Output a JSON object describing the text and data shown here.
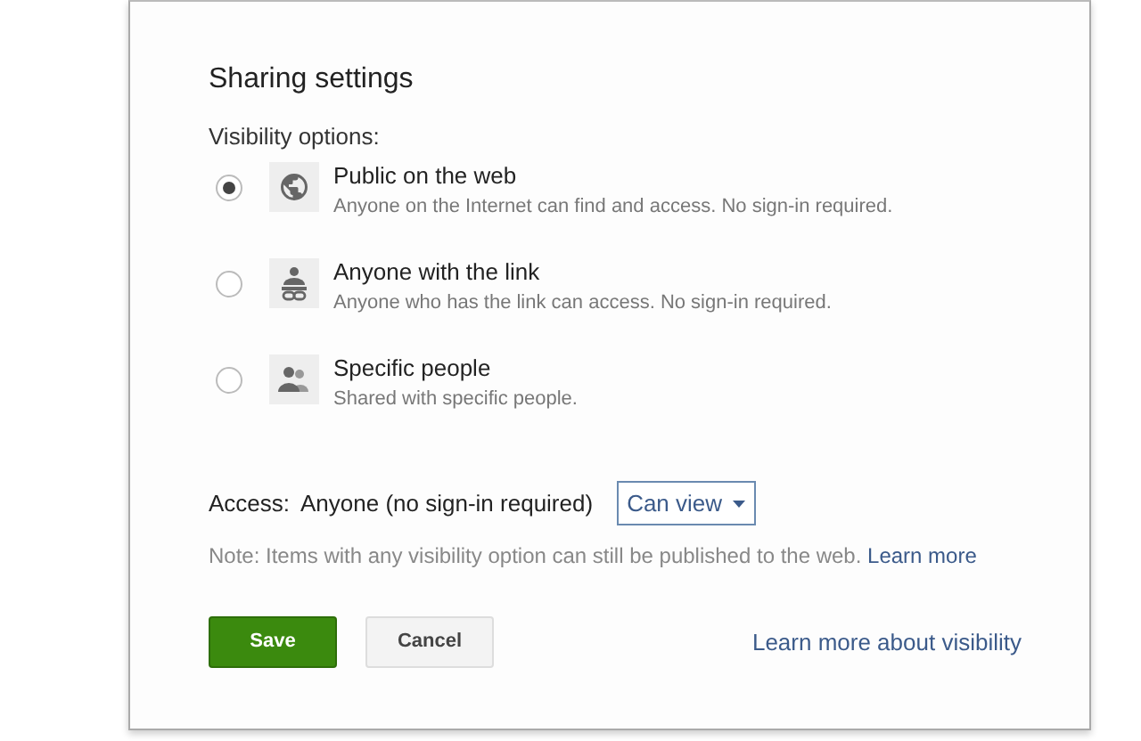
{
  "dialog": {
    "title": "Sharing settings"
  },
  "visibility": {
    "label": "Visibility options:",
    "options": [
      {
        "kind": "globe",
        "title": "Public on the web",
        "description": "Anyone on the Internet can find and access. No sign-in required.",
        "selected": true
      },
      {
        "kind": "link",
        "title": "Anyone with the link",
        "description": "Anyone who has the link can access. No sign-in required.",
        "selected": false
      },
      {
        "kind": "people",
        "title": "Specific people",
        "description": "Shared with specific people.",
        "selected": false
      }
    ]
  },
  "access": {
    "label": "Access:",
    "value": "Anyone (no sign-in required)",
    "dropdown": "Can view"
  },
  "note": {
    "text": "Note: Items with any visibility option can still be published to the web.",
    "link": "Learn more"
  },
  "buttons": {
    "save": "Save",
    "cancel": "Cancel"
  },
  "footer_link": "Learn more about visibility"
}
